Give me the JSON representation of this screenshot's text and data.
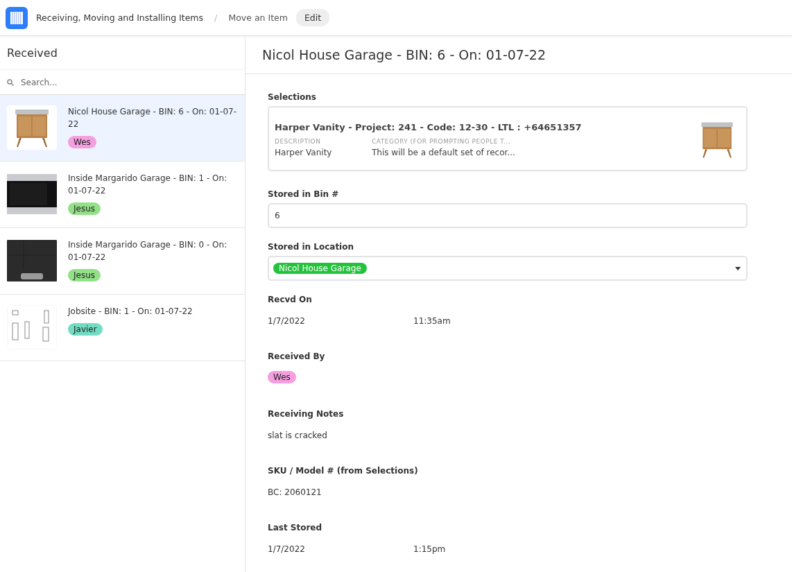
{
  "header": {
    "app_title": "Receiving, Moving and Installing Items",
    "separator": "/",
    "page": "Move an Item",
    "edit_button": "Edit"
  },
  "sidebar": {
    "title": "Received",
    "search": {
      "placeholder": "Search..."
    },
    "items": [
      {
        "title": "Nicol House Garage - BIN: 6 - On: 01-07-22",
        "tag": {
          "label": "Wes",
          "color": "#f59ee0"
        },
        "selected": true,
        "kind": "picture"
      },
      {
        "title": "Inside Margarido Garage - BIN: 1 - On: 01-07-22",
        "tag": {
          "label": "Jesus",
          "color": "#93e088"
        },
        "selected": false,
        "kind": "picture"
      },
      {
        "title": "Inside Margarido Garage - BIN: 0 - On: 01-07-22",
        "tag": {
          "label": "Jesus",
          "color": "#93e088"
        },
        "selected": false,
        "kind": "picture"
      },
      {
        "title": "Jobsite - BIN: 1 - On: 01-07-22",
        "tag": {
          "label": "Javier",
          "color": "#72ddc3"
        },
        "selected": false,
        "kind": "picture"
      }
    ]
  },
  "detail": {
    "title": "Nicol House Garage - BIN: 6 - On: 01-07-22",
    "fields": [
      {
        "kind": "record",
        "label": "Selections",
        "record": {
          "title": "Harper Vanity - Project: 241 - Code: 12-30 - LTL : +64651357",
          "columns": [
            {
              "heading": "DESCRIPTION",
              "value": "Harper Vanity"
            },
            {
              "heading": "CATEGORY (FOR PROMPTING PEOPLE T...",
              "value": "This will be a default set of recor..."
            }
          ]
        }
      },
      {
        "kind": "input",
        "label": "Stored in Bin #",
        "value": "6"
      },
      {
        "kind": "select",
        "label": "Stored in Location",
        "value": {
          "label": "Nicol House Garage",
          "color": "#22c33a"
        }
      },
      {
        "kind": "datetime",
        "label": "Recvd On",
        "date": "1/7/2022",
        "time": "11:35am"
      },
      {
        "kind": "tag",
        "label": "Received By",
        "value": {
          "label": "Wes",
          "color": "#f59ee0"
        }
      },
      {
        "kind": "text",
        "label": "Receiving Notes",
        "value": "slat is cracked"
      },
      {
        "kind": "text",
        "label": "SKU / Model # (from Selections)",
        "value": "BC: 2060121"
      },
      {
        "kind": "datetime",
        "label": "Last Stored",
        "date": "1/7/2022",
        "time": "1:15pm"
      }
    ]
  }
}
